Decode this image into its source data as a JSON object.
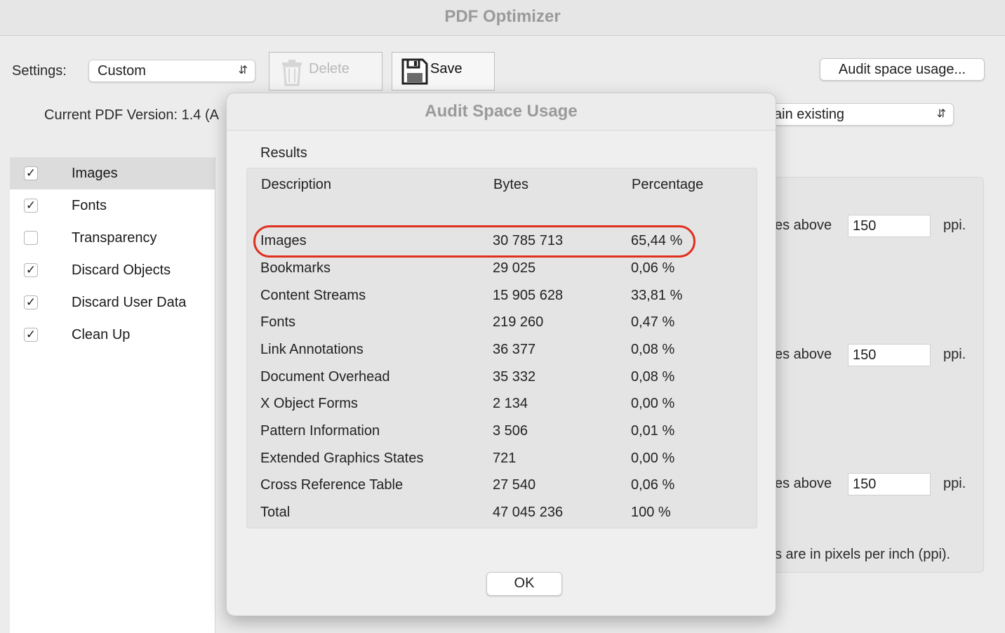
{
  "window": {
    "title": "PDF Optimizer"
  },
  "settings": {
    "label": "Settings:",
    "selected": "Custom",
    "delete_label": "Delete",
    "save_label": "Save",
    "audit_button": "Audit space usage..."
  },
  "version": {
    "text": "Current PDF Version: 1.4 (A",
    "compat_selected": "ain existing"
  },
  "sidebar": {
    "items": [
      {
        "label": "Images",
        "checked": true,
        "selected": true
      },
      {
        "label": "Fonts",
        "checked": true,
        "selected": false
      },
      {
        "label": "Transparency",
        "checked": false,
        "selected": false
      },
      {
        "label": "Discard Objects",
        "checked": true,
        "selected": false
      },
      {
        "label": "Discard User Data",
        "checked": true,
        "selected": false
      },
      {
        "label": "Clean Up",
        "checked": true,
        "selected": false
      }
    ]
  },
  "right_panel": {
    "rows": [
      {
        "prefix": "es above",
        "value": "150",
        "unit": "ppi."
      },
      {
        "prefix": "es above",
        "value": "150",
        "unit": "ppi."
      },
      {
        "prefix": "es above",
        "value": "150",
        "unit": "ppi."
      }
    ],
    "note": "s are in pixels per inch (ppi)."
  },
  "dialog": {
    "title": "Audit Space Usage",
    "results_label": "Results",
    "columns": [
      "Description",
      "Bytes",
      "Percentage"
    ],
    "rows": [
      [
        "Images",
        "30 785 713",
        "65,44 %"
      ],
      [
        "Bookmarks",
        "29 025",
        "0,06 %"
      ],
      [
        "Content Streams",
        "15 905 628",
        "33,81 %"
      ],
      [
        "Fonts",
        "219 260",
        "0,47 %"
      ],
      [
        "Link Annotations",
        "36 377",
        "0,08 %"
      ],
      [
        "Document Overhead",
        "35 332",
        "0,08 %"
      ],
      [
        "X Object Forms",
        "2 134",
        "0,00 %"
      ],
      [
        "Pattern Information",
        "3 506",
        "0,01 %"
      ],
      [
        "Extended Graphics States",
        "721",
        "0,00 %"
      ],
      [
        "Cross Reference Table",
        "27 540",
        "0,06 %"
      ],
      [
        "Total",
        "47 045 236",
        "100 %"
      ]
    ],
    "ok_label": "OK",
    "highlight_color": "#e0301e"
  }
}
